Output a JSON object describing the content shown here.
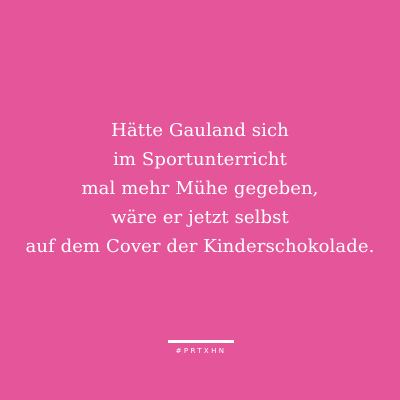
{
  "quote": {
    "lines": [
      "Hätte Gauland sich",
      "im Sportunterricht",
      "mal mehr Mühe gegeben,",
      "wäre er jetzt selbst",
      "auf dem Cover der Kinderschokolade."
    ]
  },
  "brand": {
    "tag": "#PRTXHN"
  },
  "colors": {
    "background": "#e4559a",
    "text": "#ffffff"
  }
}
